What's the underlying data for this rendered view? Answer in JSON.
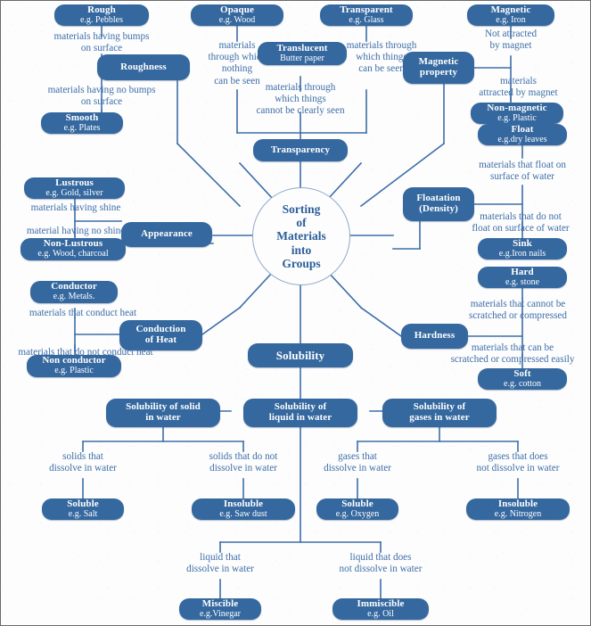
{
  "diagram": {
    "title": "Sorting of Materials into Groups",
    "hub_label": "Sorting\nof\nMaterials\ninto\nGroups",
    "accent_node_color": "#35689f",
    "accent_text_color": "#3d6ea8",
    "background_color": "#fdfdfd"
  },
  "branches": {
    "roughness": {
      "node": {
        "t1": "Roughness",
        "t2": ""
      },
      "children": [
        {
          "caption": "materials having bumps\non surface",
          "node": {
            "t1": "Rough",
            "t2": "e.g. Pebbles"
          }
        },
        {
          "caption": "materials having no bumps\non surface",
          "node": {
            "t1": "Smooth",
            "t2": "e.g. Plates"
          }
        }
      ]
    },
    "transparency": {
      "node": {
        "t1": "Transparency",
        "t2": ""
      },
      "children": [
        {
          "caption": "materials\nthrough which\nnothing\ncan be seen",
          "node": {
            "t1": "Opaque",
            "t2": "e.g. Wood"
          }
        },
        {
          "caption": "materials through\nwhich things\ncannot be clearly seen",
          "node": {
            "t1": "Translucent",
            "t2": "Butter paper"
          }
        },
        {
          "caption": "materials through\nwhich things\ncan be seen",
          "node": {
            "t1": "Transparent",
            "t2": "e.g. Glass"
          }
        }
      ]
    },
    "magnetic_property": {
      "node": {
        "t1": "Magnetic",
        "t2": "property"
      },
      "children": [
        {
          "caption": "Not attracted\nby magnet",
          "node": {
            "t1": "Magnetic",
            "t2": "e.g. Iron"
          }
        },
        {
          "caption": "materials\nattracted by magnet",
          "node": {
            "t1": "Non-magnetic",
            "t2": "e.g. Plastic"
          }
        }
      ]
    },
    "appearance": {
      "node": {
        "t1": "Appearance",
        "t2": ""
      },
      "children": [
        {
          "caption": "materials having shine",
          "node": {
            "t1": "Lustrous",
            "t2": "e.g. Gold, silver"
          }
        },
        {
          "caption": "material having no shine",
          "node": {
            "t1": "Non-Lustrous",
            "t2": "e.g. Wood, charcoal"
          }
        }
      ]
    },
    "floatation": {
      "node": {
        "t1": "Floatation",
        "t2": "(Density)"
      },
      "children": [
        {
          "caption": "materials that float on\nsurface of water",
          "node": {
            "t1": "Float",
            "t2": "e.g.dry leaves"
          }
        },
        {
          "caption": "materials that do not\nfloat on surface of water",
          "node": {
            "t1": "Sink",
            "t2": "e.g.Iron nails"
          }
        }
      ]
    },
    "conduction_of_heat": {
      "node": {
        "t1": "Conduction",
        "t2": "of Heat"
      },
      "children": [
        {
          "caption": "materials that conduct heat",
          "node": {
            "t1": "Conductor",
            "t2": "e.g. Metals."
          }
        },
        {
          "caption": "materials that do not conduct heat",
          "node": {
            "t1": "Non conductor",
            "t2": "e.g. Plastic"
          }
        }
      ]
    },
    "hardness": {
      "node": {
        "t1": "Hardness",
        "t2": ""
      },
      "children": [
        {
          "caption": "materials that cannot be\nscratched or compressed",
          "node": {
            "t1": "Hard",
            "t2": "e.g. stone"
          }
        },
        {
          "caption": "materials that can be\nscratched or compressed easily",
          "node": {
            "t1": "Soft",
            "t2": "e.g. cotton"
          }
        }
      ]
    },
    "solubility": {
      "node": {
        "t1": "Solubility",
        "t2": ""
      },
      "groups": [
        {
          "node": {
            "t1": "Solubility of solid",
            "t2": "in water"
          },
          "children": [
            {
              "caption": "solids that\ndissolve in water",
              "node": {
                "t1": "Soluble",
                "t2": "e.g. Salt"
              }
            },
            {
              "caption": "solids that do not\ndissolve in water",
              "node": {
                "t1": "Insoluble",
                "t2": "e.g. Saw dust"
              }
            }
          ]
        },
        {
          "node": {
            "t1": "Solubility of",
            "t2": "liquid in water"
          },
          "children": [
            {
              "caption": "liquid that\ndissolve in water",
              "node": {
                "t1": "Miscible",
                "t2": "e.g.Vinegar"
              }
            },
            {
              "caption": "liquid that does\nnot dissolve in water",
              "node": {
                "t1": "Immiscible",
                "t2": "e.g. Oil"
              }
            }
          ]
        },
        {
          "node": {
            "t1": "Solubility of",
            "t2": "gases in water"
          },
          "children": [
            {
              "caption": "gases that\ndissolve in water",
              "node": {
                "t1": "Soluble",
                "t2": "e.g. Oxygen"
              }
            },
            {
              "caption": "gases that does\nnot dissolve in water",
              "node": {
                "t1": "Insoluble",
                "t2": "e.g. Nitrogen"
              }
            }
          ]
        }
      ]
    }
  }
}
